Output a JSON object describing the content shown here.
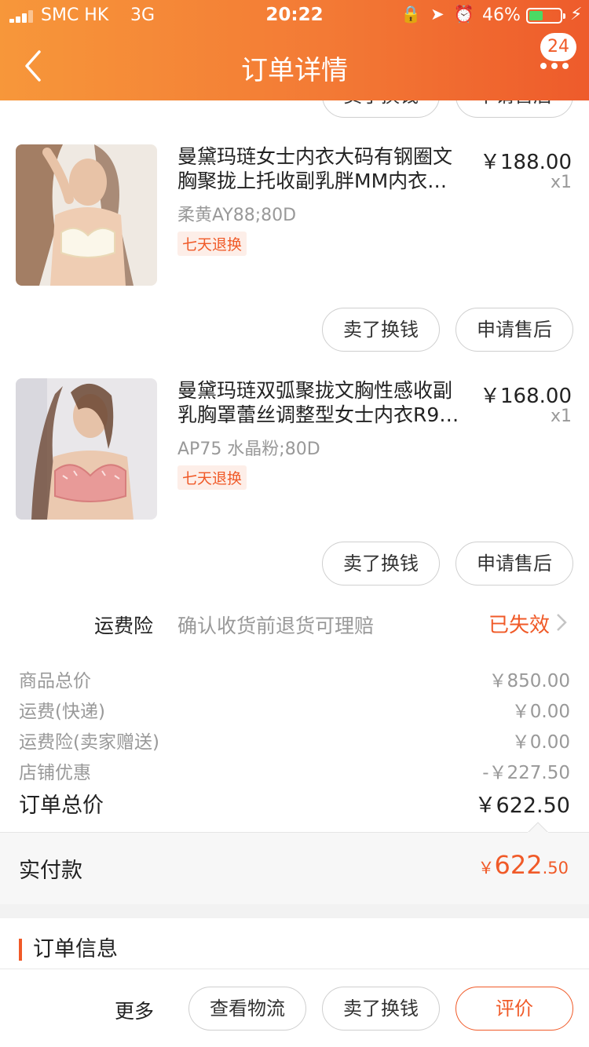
{
  "status_bar": {
    "carrier": "SMC HK",
    "network": "3G",
    "time": "20:22",
    "battery_pct": "46%",
    "battery_level": 0.46,
    "icons": [
      "orientation-lock-icon",
      "location-arrow-icon",
      "alarm-icon",
      "charging-bolt-icon"
    ]
  },
  "header": {
    "title": "订单详情",
    "badge": "24",
    "bg_color": "#f37a35"
  },
  "partial_buttons": {
    "sell": "卖了换钱",
    "after_sale": "申请售后"
  },
  "items": [
    {
      "title_line1": "曼黛玛琏女士内衣大码有钢圈文",
      "title_line2": "胸聚拢上托收副乳胖MM内衣…",
      "spec": "柔黄AY88;80D",
      "tag": "七天退换",
      "price": "￥188.00",
      "qty": "x1",
      "sell_label": "卖了换钱",
      "after_sale_label": "申请售后"
    },
    {
      "title_line1": "曼黛玛琏双弧聚拢文胸性感收副",
      "title_line2": "乳胸罩蕾丝调整型女士内衣R9…",
      "spec": "AP75 水晶粉;80D",
      "tag": "七天退换",
      "price": "￥168.00",
      "qty": "x1",
      "sell_label": "卖了换钱",
      "after_sale_label": "申请售后"
    }
  ],
  "insurance": {
    "label": "运费险",
    "desc": "确认收货前退货可理赔",
    "status": "已失效"
  },
  "summary": {
    "rows": [
      {
        "label": "商品总价",
        "value": "￥850.00"
      },
      {
        "label": "运费(快递)",
        "value": "￥0.00"
      },
      {
        "label": "运费险(卖家赠送)",
        "value": "￥0.00"
      },
      {
        "label": "店铺优惠",
        "value": "-￥227.50"
      }
    ],
    "total_label": "订单总价",
    "total_value": "￥622.50"
  },
  "paid": {
    "label": "实付款",
    "currency": "￥",
    "int": "622",
    "dec": ".50"
  },
  "order_info": {
    "title": "订单信息"
  },
  "bottom_bar": {
    "more": "更多",
    "logistics": "查看物流",
    "sell": "卖了换钱",
    "review": "评价"
  },
  "colors": {
    "accent": "#f05a28",
    "muted": "#999999"
  }
}
